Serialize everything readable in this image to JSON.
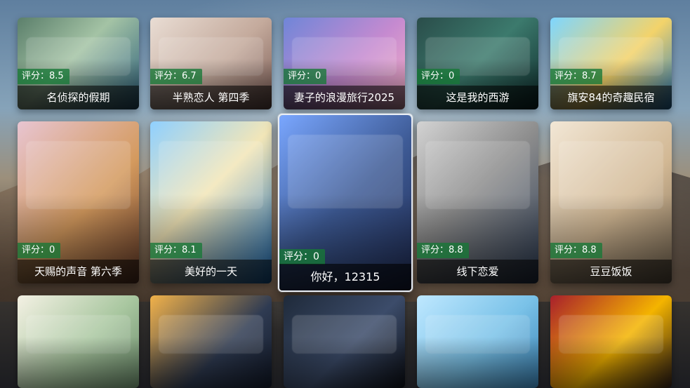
{
  "rating_prefix": "评分：",
  "row1": [
    {
      "title": "名侦探的假期",
      "rating": "8.5",
      "accent": "#6c9a7b"
    },
    {
      "title": "半熟恋人 第四季",
      "rating": "6.7",
      "accent": "#d8c1b2"
    },
    {
      "title": "妻子的浪漫旅行2025",
      "rating": "0",
      "accent": "#b58bd3"
    },
    {
      "title": "这是我的西游",
      "rating": "0",
      "accent": "#2f6b5f"
    },
    {
      "title": "旗安84的奇趣民宿",
      "rating": "8.7",
      "accent": "#6fc1e5"
    }
  ],
  "row2": [
    {
      "title": "天赐的声音 第六季",
      "rating": "0",
      "accent": "#c58a5a"
    },
    {
      "title": "美好的一天",
      "rating": "8.1",
      "accent": "#4aa5d8"
    },
    {
      "title": "你好，12315",
      "rating": "0",
      "accent": "#3b5f9b",
      "selected": true
    },
    {
      "title": "线下恋爱",
      "rating": "8.8",
      "accent": "#9b9b9b"
    },
    {
      "title": "豆豆饭饭",
      "rating": "8.8",
      "accent": "#d6c3a7"
    }
  ],
  "row3": [
    {
      "title": "",
      "rating": "",
      "accent": "#9dbb97"
    },
    {
      "title": "",
      "rating": "",
      "accent": "#f0b33c"
    },
    {
      "title": "",
      "rating": "",
      "accent": "#2a2f3a"
    },
    {
      "title": "",
      "rating": "",
      "accent": "#8ac4e8"
    },
    {
      "title": "",
      "rating": "",
      "accent": "#c33b3b"
    }
  ]
}
